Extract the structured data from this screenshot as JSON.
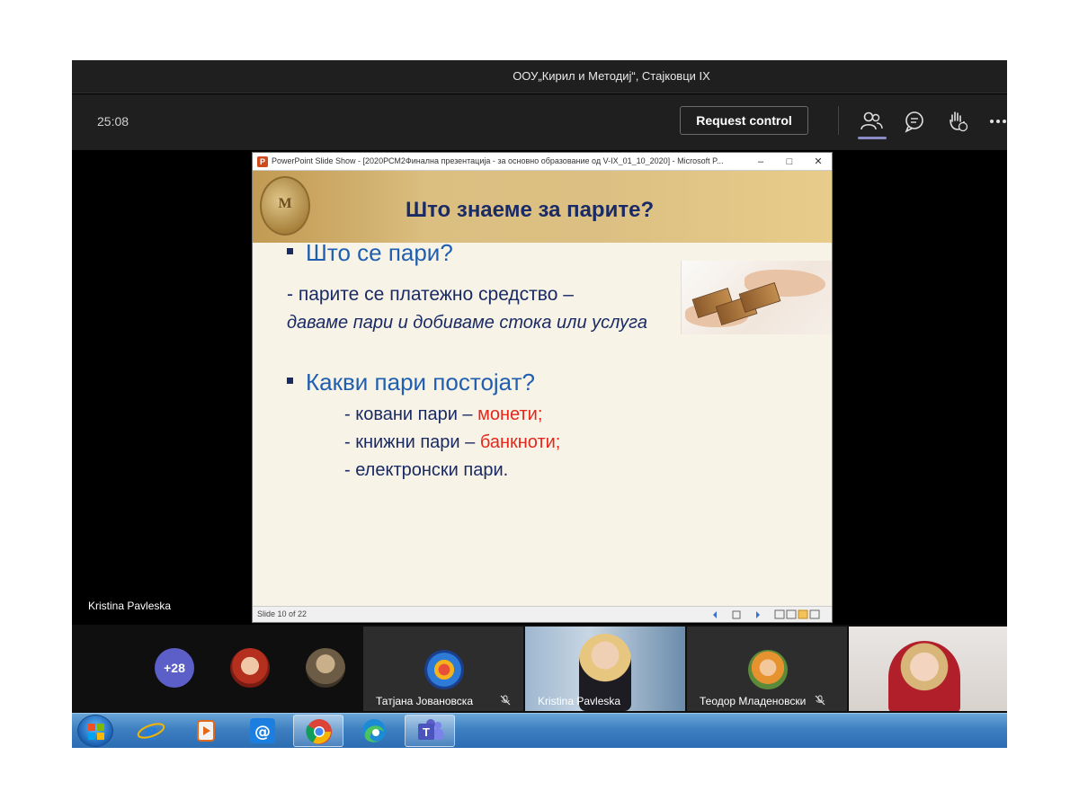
{
  "meeting": {
    "title": "ООУ„Кирил и Методиј“, Стајковци IX",
    "timer": "25:08",
    "request_control_label": "Request control",
    "toolbar_icons": [
      "people-icon",
      "chat-icon",
      "raise-hand-icon",
      "more-options-icon"
    ]
  },
  "presenter_label": "Kristina Pavleska",
  "ppt_window": {
    "title": "PowerPoint Slide Show - [2020РСМ2Финална презентација - за основно образование од V-IX_01_10_2020] - Microsoft P...",
    "minimize": "–",
    "restore": "□",
    "close": "✕",
    "slide_counter": "Slide 10 of 22"
  },
  "slide": {
    "title": "Што знаеме за парите?",
    "coin_letters": "M\nNIKO",
    "bullet1": "Што се пари?",
    "dash_line": "- парите се платежно средство –",
    "italic_line": "даваме пари и добиваме стока или услуга",
    "bullet2": "Какви пари постојат?",
    "item1_text": "- ковани пари – ",
    "item1_red": "монети;",
    "item2_text": "- книжни пари – ",
    "item2_red": "банкноти;",
    "item3_text": "- електронски пари."
  },
  "participants": {
    "more_count": "+28",
    "tiles": [
      {
        "name": "Татјана Јовановска",
        "muted": true
      },
      {
        "name": "Kristina Pavleska",
        "muted": false
      },
      {
        "name": "Теодор Младеновски",
        "muted": true
      }
    ]
  },
  "taskbar": {
    "items": [
      "start-button",
      "internet-explorer-icon",
      "media-player-icon",
      "mail-icon",
      "chrome-icon",
      "edge-icon",
      "teams-icon"
    ]
  },
  "colors": {
    "accent": "#5b5fc7",
    "slide_blue": "#1f5eb0",
    "slide_navy": "#1a2a64",
    "slide_red": "#e4271c"
  }
}
